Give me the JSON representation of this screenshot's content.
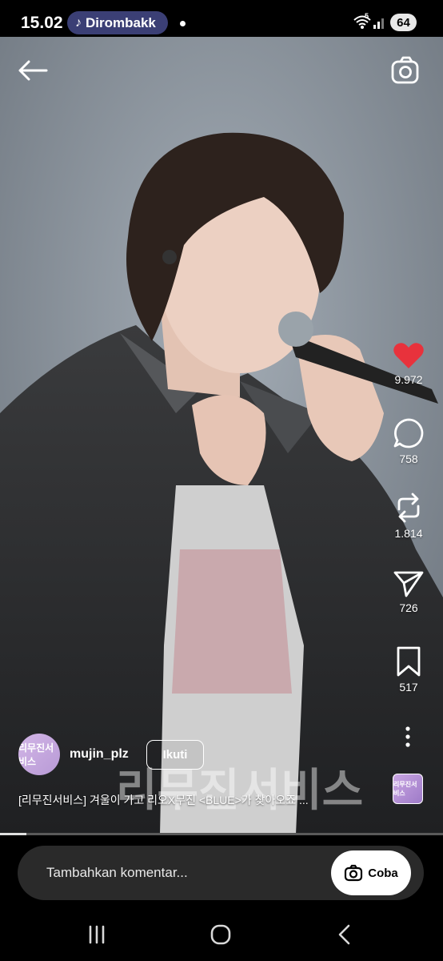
{
  "status_bar": {
    "time": "15.02",
    "app_label": "Dirombakk",
    "battery": "64",
    "network": "5"
  },
  "post": {
    "username": "mujin_plz",
    "follow_label": "Ikuti",
    "caption": "[리무진서비스] 겨울이 가고 리오X무진 <BLUE>가 찾아오죠 ...",
    "avatar_text": "리무진서비스",
    "progress": 0.06
  },
  "actions": {
    "likes": "9.972",
    "comments": "758",
    "reposts": "1.814",
    "shares": "726",
    "saves": "517"
  },
  "comment_bar": {
    "placeholder": "Tambahkan komentar...",
    "try_label": "Coba"
  },
  "colors": {
    "like": "#e8323c",
    "pill": "#3b3f75"
  }
}
